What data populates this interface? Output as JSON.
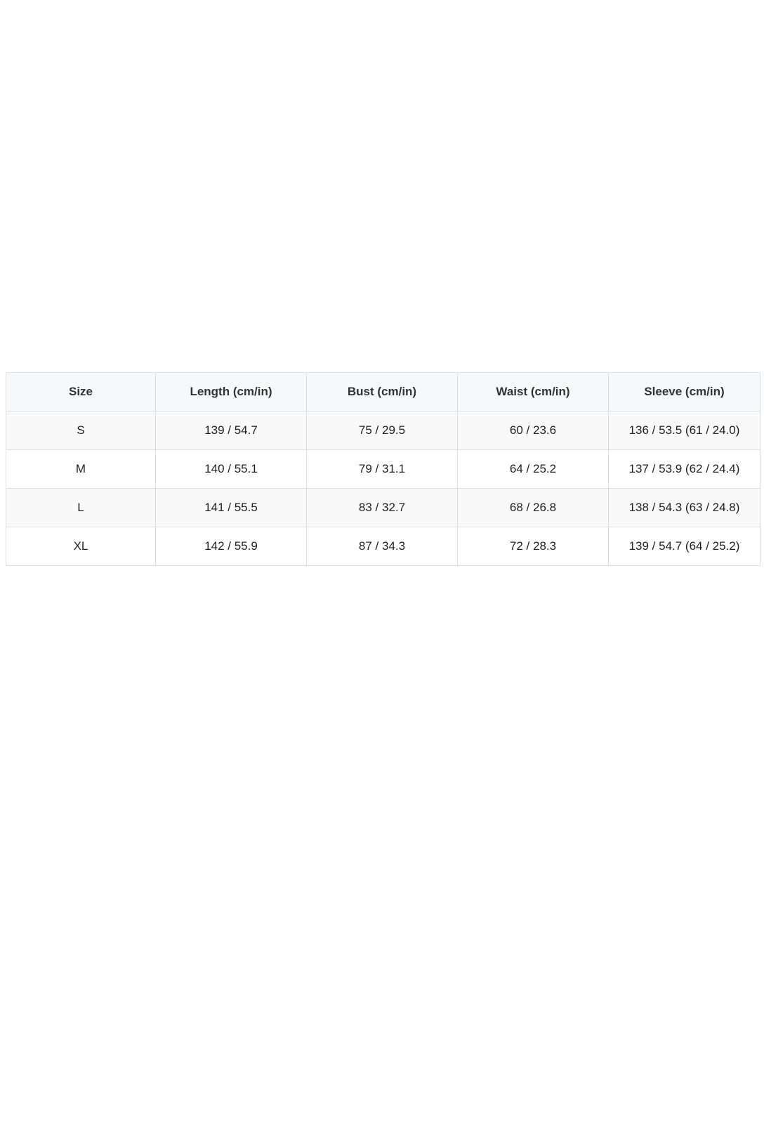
{
  "size_chart": {
    "headers": [
      "Size",
      "Length (cm/in)",
      "Bust (cm/in)",
      "Waist (cm/in)",
      "Sleeve (cm/in)"
    ],
    "rows": [
      [
        "S",
        "139 / 54.7",
        "75 / 29.5",
        "60 / 23.6",
        "136 / 53.5 (61 / 24.0)"
      ],
      [
        "M",
        "140 / 55.1",
        "79 / 31.1",
        "64 / 25.2",
        "137 / 53.9 (62 / 24.4)"
      ],
      [
        "L",
        "141 / 55.5",
        "83 / 32.7",
        "68 / 26.8",
        "138 / 54.3 (63 / 24.8)"
      ],
      [
        "XL",
        "142 / 55.9",
        "87 / 34.3",
        "72 / 28.3",
        "139 / 54.7 (64 / 25.2)"
      ]
    ]
  },
  "colors": {
    "header_bg": "#f6f8fa",
    "odd_row_bg": "#f9f9f9",
    "even_row_bg": "#ffffff",
    "border": "#dfe2e5"
  }
}
